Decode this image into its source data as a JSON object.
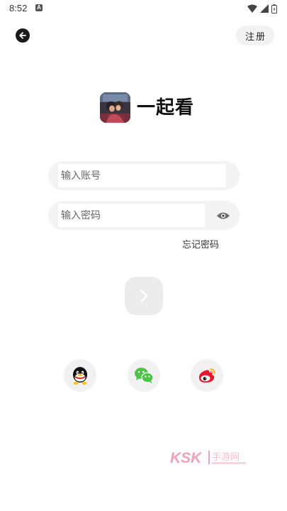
{
  "status_bar": {
    "time": "8:52",
    "notification_letter": "A"
  },
  "header": {
    "register_label": "注册"
  },
  "brand": {
    "app_name": "一起看"
  },
  "form": {
    "account_placeholder": "输入账号",
    "password_placeholder": "输入密码",
    "forgot_password_label": "忘记密码"
  },
  "social_login": {
    "icons": [
      "qq-icon",
      "wechat-icon",
      "weibo-icon"
    ]
  },
  "watermark": {
    "brand": "KSK",
    "text": "手游网"
  },
  "colors": {
    "qq_yellow": "#f7c51c",
    "wechat_green": "#4fc24a",
    "weibo_red": "#e6162d",
    "watermark_pink": "#f2a0b8"
  }
}
